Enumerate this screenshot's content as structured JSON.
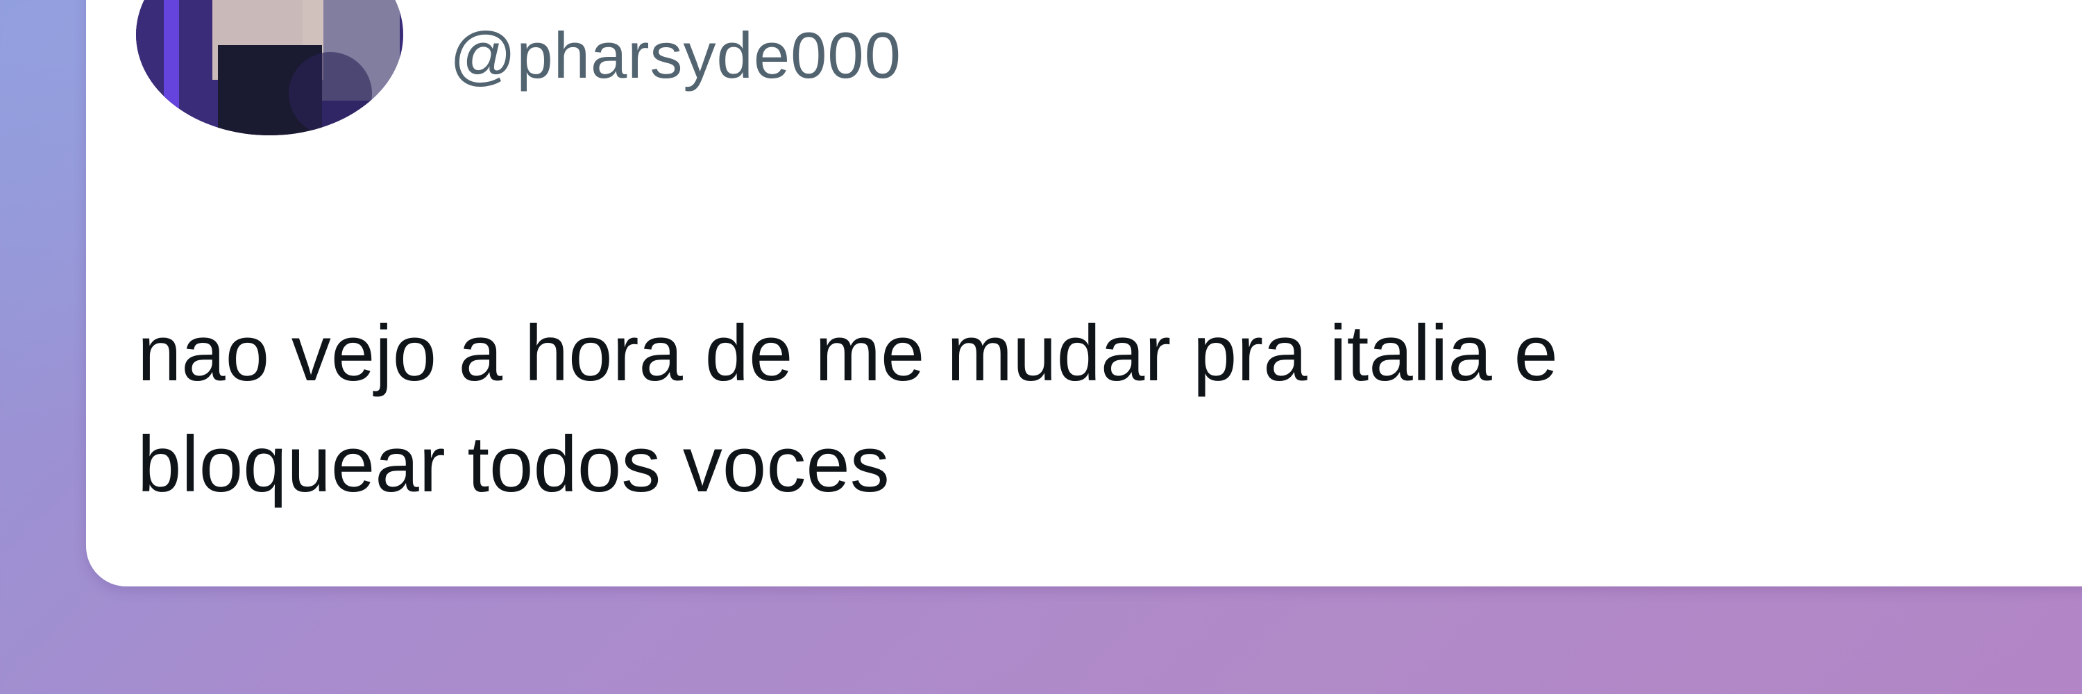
{
  "tweet": {
    "handle": "@pharsyde000",
    "text_lines": [
      "nao vejo a hora de me mudar pra italia e",
      "bloquear todos voces"
    ]
  },
  "colors": {
    "card_background": "#ffffff",
    "handle_text": "#536471",
    "body_text": "#0f1419",
    "page_gradient_start": "#8f96d8",
    "page_gradient_end": "#b286c6"
  },
  "icons": {
    "avatar": "profile-photo"
  }
}
